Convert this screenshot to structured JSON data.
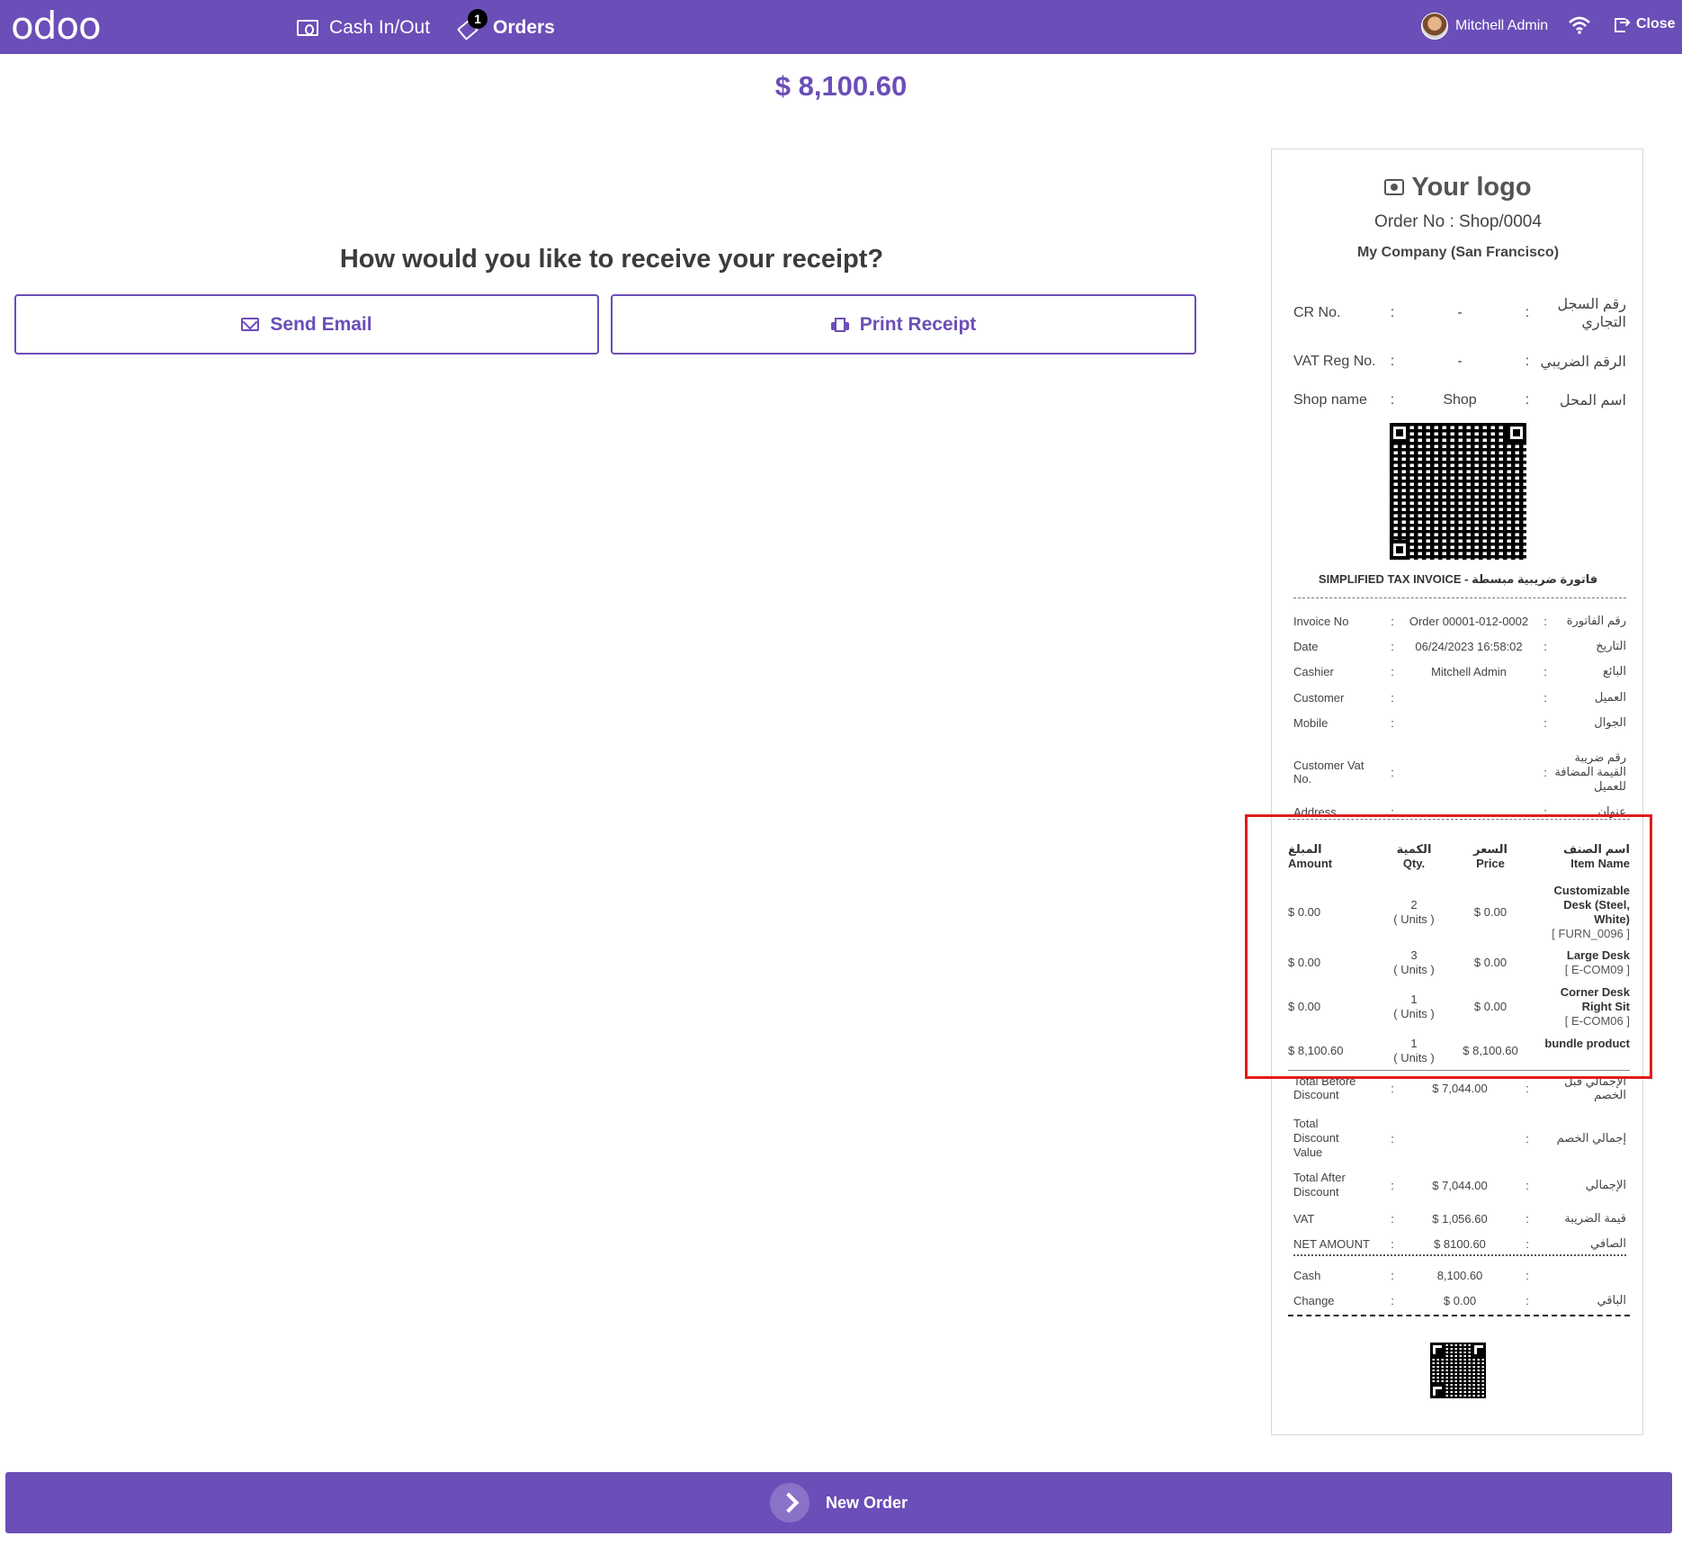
{
  "nav": {
    "logo": "odoo",
    "cash_label": "Cash In/Out",
    "orders_label": "Orders",
    "orders_badge": "1",
    "user_name": "Mitchell Admin",
    "close_label": "Close"
  },
  "total": "$ 8,100.60",
  "question": "How would you like to receive your receipt?",
  "buttons": {
    "email": "Send Email",
    "print": "Print Receipt",
    "new_order": "New Order"
  },
  "receipt": {
    "logo_text": "Your logo",
    "order_no": "Order No : Shop/0004",
    "company": "My Company (San Francisco)",
    "header_rows": [
      {
        "en": "CR No.",
        "value": "-",
        "ar": "رقم السجل التجاري"
      },
      {
        "en": "VAT Reg No.",
        "value": "-",
        "ar": "الرقم الضريبي"
      },
      {
        "en": "Shop name",
        "value": "Shop",
        "ar": "اسم المحل"
      }
    ],
    "sep": ":",
    "invoice_title": "SIMPLIFIED TAX INVOICE - فاتورة ضريبية مبسطة",
    "info_rows": [
      {
        "en": "Invoice No",
        "value": "Order 00001-012-0002",
        "ar": "رقم الفاتورة"
      },
      {
        "en": "Date",
        "value": "06/24/2023 16:58:02",
        "ar": "التاريخ"
      },
      {
        "en": "Cashier",
        "value": "Mitchell Admin",
        "ar": "البائع"
      },
      {
        "en": "Customer",
        "value": "",
        "ar": "العميل"
      },
      {
        "en": "Mobile",
        "value": "",
        "ar": "الجوال"
      },
      {
        "en": "Customer Vat No.",
        "value": "",
        "ar": "رقم ضريبة القيمة المضافة للعميل"
      },
      {
        "en": "Address",
        "value": "",
        "ar": "عنوان"
      }
    ],
    "items_header": {
      "amount_ar": "المبلغ",
      "amount_en": "Amount",
      "qty_ar": "الكمية",
      "qty_en": "Qty.",
      "price_ar": "السعر",
      "price_en": "Price",
      "name_ar": "اسم الصنف",
      "name_en": "Item Name"
    },
    "items": [
      {
        "amount": "$ 0.00",
        "qty": "2",
        "unit": "( Units )",
        "price": "$ 0.00",
        "name": "Customizable Desk (Steel, White)",
        "code": "[ FURN_0096 ]"
      },
      {
        "amount": "$ 0.00",
        "qty": "3",
        "unit": "( Units )",
        "price": "$ 0.00",
        "name": "Large Desk",
        "code": "[ E-COM09 ]"
      },
      {
        "amount": "$ 0.00",
        "qty": "1",
        "unit": "( Units )",
        "price": "$ 0.00",
        "name": "Corner Desk Right Sit",
        "code": "[ E-COM06 ]"
      },
      {
        "amount": "$ 8,100.60",
        "qty": "1",
        "unit": "( Units )",
        "price": "$ 8,100.60",
        "name": "bundle product",
        "code": ""
      }
    ],
    "totals": [
      {
        "en": "Total Before Discount",
        "value": "$ 7,044.00",
        "ar": "الإجمالي قبل الخصم"
      },
      {
        "en": "Total Discount Value",
        "value": "",
        "ar": "إجمالي الخصم"
      },
      {
        "en": "Total After Discount",
        "value": "$ 7,044.00",
        "ar": "الإجمالي"
      },
      {
        "en": "VAT",
        "value": "$ 1,056.60",
        "ar": "قيمة الضريبة"
      },
      {
        "en": "NET AMOUNT",
        "value": "$ 8100.60",
        "ar": "الصافي"
      }
    ],
    "payments": [
      {
        "en": "Cash",
        "value": "8,100.60",
        "ar": ""
      },
      {
        "en": "Change",
        "value": "$ 0.00",
        "ar": "الباقي"
      }
    ]
  },
  "colors": {
    "brand": "#6b4eb7",
    "highlight": "#e21b1b"
  }
}
